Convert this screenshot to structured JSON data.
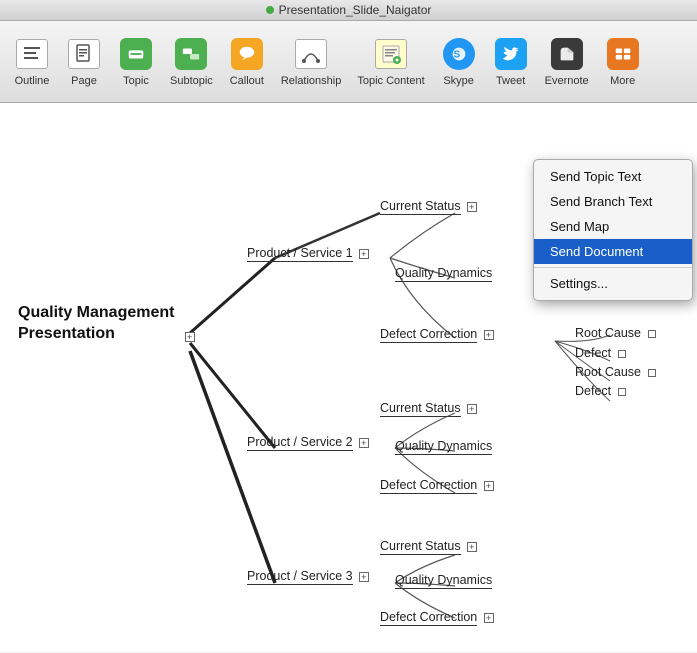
{
  "titlebar": {
    "title": "Presentation_Slide_Naigator",
    "dot_color": "#4caf50"
  },
  "toolbar": {
    "items": [
      {
        "label": "Outline",
        "icon": "outline-icon"
      },
      {
        "label": "Page",
        "icon": "page-icon"
      },
      {
        "label": "Topic",
        "icon": "topic-icon"
      },
      {
        "label": "Subtopic",
        "icon": "subtopic-icon"
      },
      {
        "label": "Callout",
        "icon": "callout-icon"
      },
      {
        "label": "Relationship",
        "icon": "relationship-icon"
      },
      {
        "label": "Topic Content",
        "icon": "topic-content-icon"
      },
      {
        "label": "Skype",
        "icon": "skype-icon"
      },
      {
        "label": "Tweet",
        "icon": "tweet-icon"
      },
      {
        "label": "Evernote",
        "icon": "evernote-icon"
      },
      {
        "label": "More",
        "icon": "more-icon"
      }
    ]
  },
  "dropdown": {
    "items": [
      {
        "label": "Send Topic Text",
        "selected": false
      },
      {
        "label": "Send Branch Text",
        "selected": false
      },
      {
        "label": "Send Map",
        "selected": false
      },
      {
        "label": "Send Document",
        "selected": true
      },
      {
        "label": "Settings...",
        "selected": false
      }
    ]
  },
  "mindmap": {
    "central": {
      "line1": "Quality Management",
      "line2": "Presentation"
    },
    "branches": [
      {
        "label": "Product / Service 1",
        "children": [
          {
            "label": "Current Status"
          },
          {
            "label": "Quality Dynamics"
          },
          {
            "label": "Defect Correction",
            "children": [
              {
                "label": "Root Cause"
              },
              {
                "label": "Defect"
              },
              {
                "label": "Root Cause"
              },
              {
                "label": "Defect"
              }
            ]
          }
        ]
      },
      {
        "label": "Product / Service 2",
        "children": [
          {
            "label": "Current Status"
          },
          {
            "label": "Quality Dynamics"
          },
          {
            "label": "Defect Correction"
          }
        ]
      },
      {
        "label": "Product / Service 3",
        "children": [
          {
            "label": "Current Status"
          },
          {
            "label": "Quality Dynamics"
          },
          {
            "label": "Defect Correction"
          }
        ]
      }
    ]
  }
}
